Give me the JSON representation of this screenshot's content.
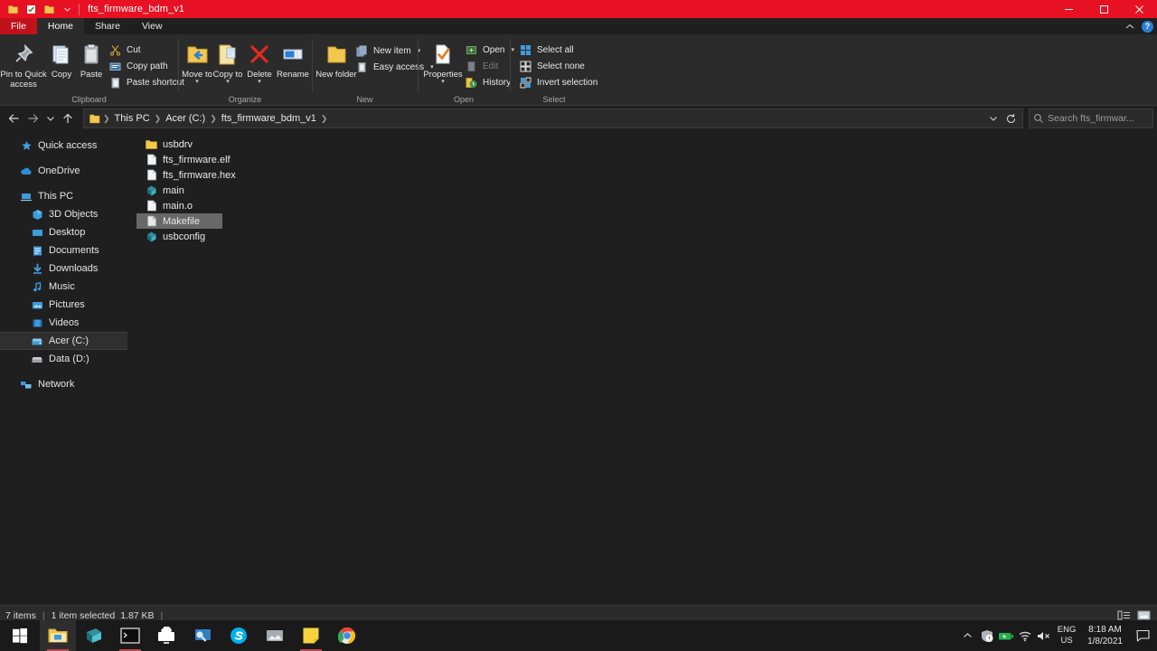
{
  "window": {
    "title": "fts_firmware_bdm_v1",
    "quick_access": [
      {
        "name": "qat-folder-icon",
        "icon": "folder-icon"
      },
      {
        "name": "qat-properties-icon",
        "icon": "properties-check-icon"
      },
      {
        "name": "qat-new-folder-icon",
        "icon": "folder-icon"
      },
      {
        "name": "qat-customize-icon",
        "icon": "chevron-down-icon"
      }
    ],
    "controls": {
      "minimize": "minimize-icon",
      "maximize": "maximize-icon",
      "close": "close-icon"
    },
    "ribbon_collapse": "chevron-up-icon",
    "help": "?"
  },
  "tabs": [
    {
      "label": "File",
      "style": "file"
    },
    {
      "label": "Home",
      "style": "active"
    },
    {
      "label": "Share",
      "style": "normal"
    },
    {
      "label": "View",
      "style": "normal"
    }
  ],
  "ribbon": {
    "groups": [
      {
        "label": "Clipboard",
        "big_buttons": [
          {
            "label": "Pin to Quick access",
            "icon": "pin-icon"
          },
          {
            "label": "Copy",
            "icon": "copy-icon"
          },
          {
            "label": "Paste",
            "icon": "paste-icon"
          }
        ],
        "small_buttons": [
          {
            "label": "Cut",
            "icon": "scissors-icon",
            "disabled": false
          },
          {
            "label": "Copy path",
            "icon": "copy-path-icon",
            "disabled": false
          },
          {
            "label": "Paste shortcut",
            "icon": "paste-shortcut-icon",
            "disabled": false
          }
        ]
      },
      {
        "label": "Organize",
        "big_buttons": [
          {
            "label": "Move to",
            "icon": "move-to-icon",
            "has_caret": true
          },
          {
            "label": "Copy to",
            "icon": "copy-to-icon",
            "has_caret": true
          },
          {
            "label": "Delete",
            "icon": "delete-icon",
            "has_caret": true
          },
          {
            "label": "Rename",
            "icon": "rename-icon"
          }
        ],
        "small_buttons": []
      },
      {
        "label": "New",
        "big_buttons": [
          {
            "label": "New folder",
            "icon": "new-folder-icon"
          }
        ],
        "small_buttons": [
          {
            "label": "New item",
            "icon": "new-item-icon",
            "caret": true
          },
          {
            "label": "Easy access",
            "icon": "easy-access-icon",
            "caret": true
          }
        ]
      },
      {
        "label": "Open",
        "big_buttons": [
          {
            "label": "Properties",
            "icon": "properties-icon",
            "has_caret": true
          }
        ],
        "small_buttons": [
          {
            "label": "Open",
            "icon": "open-icon",
            "caret": true,
            "disabled": false
          },
          {
            "label": "Edit",
            "icon": "edit-icon",
            "disabled": true
          },
          {
            "label": "History",
            "icon": "history-icon",
            "disabled": false
          }
        ]
      },
      {
        "label": "Select",
        "big_buttons": [],
        "small_buttons": [
          {
            "label": "Select all",
            "icon": "select-all-icon"
          },
          {
            "label": "Select none",
            "icon": "select-none-icon"
          },
          {
            "label": "Invert selection",
            "icon": "invert-selection-icon"
          }
        ]
      }
    ]
  },
  "address_bar": {
    "back": "back-arrow-icon",
    "forward": "forward-arrow-icon",
    "recent": "chevron-down-icon",
    "up": "up-arrow-icon",
    "crumbs": [
      "This PC",
      "Acer (C:)",
      "fts_firmware_bdm_v1"
    ],
    "dropdown": "chevron-down-icon",
    "refresh": "refresh-icon",
    "search_placeholder": "Search fts_firmwar..."
  },
  "sidebar": {
    "items": [
      {
        "label": "Quick access",
        "icon": "star-icon",
        "indent": false,
        "selected": false
      },
      {
        "label": "OneDrive",
        "icon": "cloud-icon",
        "indent": false,
        "selected": false,
        "gap_before": true
      },
      {
        "label": "This PC",
        "icon": "pc-icon",
        "indent": false,
        "selected": false,
        "gap_before": true
      },
      {
        "label": "3D Objects",
        "icon": "cube-icon",
        "indent": true,
        "selected": false
      },
      {
        "label": "Desktop",
        "icon": "desktop-icon",
        "indent": true,
        "selected": false
      },
      {
        "label": "Documents",
        "icon": "documents-icon",
        "indent": true,
        "selected": false
      },
      {
        "label": "Downloads",
        "icon": "download-icon",
        "indent": true,
        "selected": false
      },
      {
        "label": "Music",
        "icon": "music-icon",
        "indent": true,
        "selected": false
      },
      {
        "label": "Pictures",
        "icon": "pictures-icon",
        "indent": true,
        "selected": false
      },
      {
        "label": "Videos",
        "icon": "videos-icon",
        "indent": true,
        "selected": false
      },
      {
        "label": "Acer (C:)",
        "icon": "drive-icon",
        "indent": true,
        "selected": true
      },
      {
        "label": "Data (D:)",
        "icon": "drive-icon",
        "indent": true,
        "selected": false
      },
      {
        "label": "Network",
        "icon": "network-icon",
        "indent": false,
        "selected": false,
        "gap_before": true
      }
    ]
  },
  "files": [
    {
      "name": "usbdrv",
      "icon": "folder-icon",
      "selected": false
    },
    {
      "name": "fts_firmware.elf",
      "icon": "file-blank-icon",
      "selected": false
    },
    {
      "name": "fts_firmware.hex",
      "icon": "file-blank-icon",
      "selected": false
    },
    {
      "name": "main",
      "icon": "c-source-icon",
      "selected": false
    },
    {
      "name": "main.o",
      "icon": "file-blank-icon",
      "selected": false
    },
    {
      "name": "Makefile",
      "icon": "file-blank-icon",
      "selected": true
    },
    {
      "name": "usbconfig",
      "icon": "c-source-icon",
      "selected": false
    }
  ],
  "status_bar": {
    "item_count": "7 items",
    "selection": "1 item selected",
    "size": "1.87 KB",
    "view_details": "details-view-icon",
    "view_large": "large-icons-view-icon"
  },
  "taskbar": {
    "start": "windows-start-icon",
    "apps": [
      {
        "name": "file-explorer",
        "icon": "folder-icon",
        "active": true,
        "underline": true
      },
      {
        "name": "atmel-studio",
        "icon": "teal-book-icon",
        "active": false,
        "underline": false
      },
      {
        "name": "terminal",
        "icon": "terminal-icon",
        "active": false,
        "underline": true
      },
      {
        "name": "screen-share",
        "icon": "monitor-cloud-icon",
        "active": false,
        "underline": false
      },
      {
        "name": "media-app",
        "icon": "blue-screen-icon",
        "active": false,
        "underline": false
      },
      {
        "name": "skype",
        "icon": "skype-icon",
        "active": false,
        "underline": false
      },
      {
        "name": "photos",
        "icon": "photos-icon",
        "active": false,
        "underline": false
      },
      {
        "name": "sticky-notes",
        "icon": "sticky-note-icon",
        "active": false,
        "underline": true
      },
      {
        "name": "chrome",
        "icon": "chrome-icon",
        "active": false,
        "underline": false
      }
    ],
    "tray": {
      "show_hidden": "chevron-up-icon",
      "icons": [
        "security-icon",
        "battery-icon",
        "wifi-icon",
        "volume-mute-icon"
      ],
      "lang_line1": "ENG",
      "lang_line2": "US",
      "time": "8:18 AM",
      "date": "1/8/2021",
      "action_center": "action-center-icon"
    }
  },
  "colors": {
    "titlebar_red": "#e81123",
    "file_tab_red": "#c1121c",
    "accent_blue": "#2a7fd4",
    "folder_yellow": "#f5c451",
    "selection_gray": "#686868",
    "window_bg": "#1f1f1f",
    "ribbon_bg": "#2b2b2b"
  }
}
